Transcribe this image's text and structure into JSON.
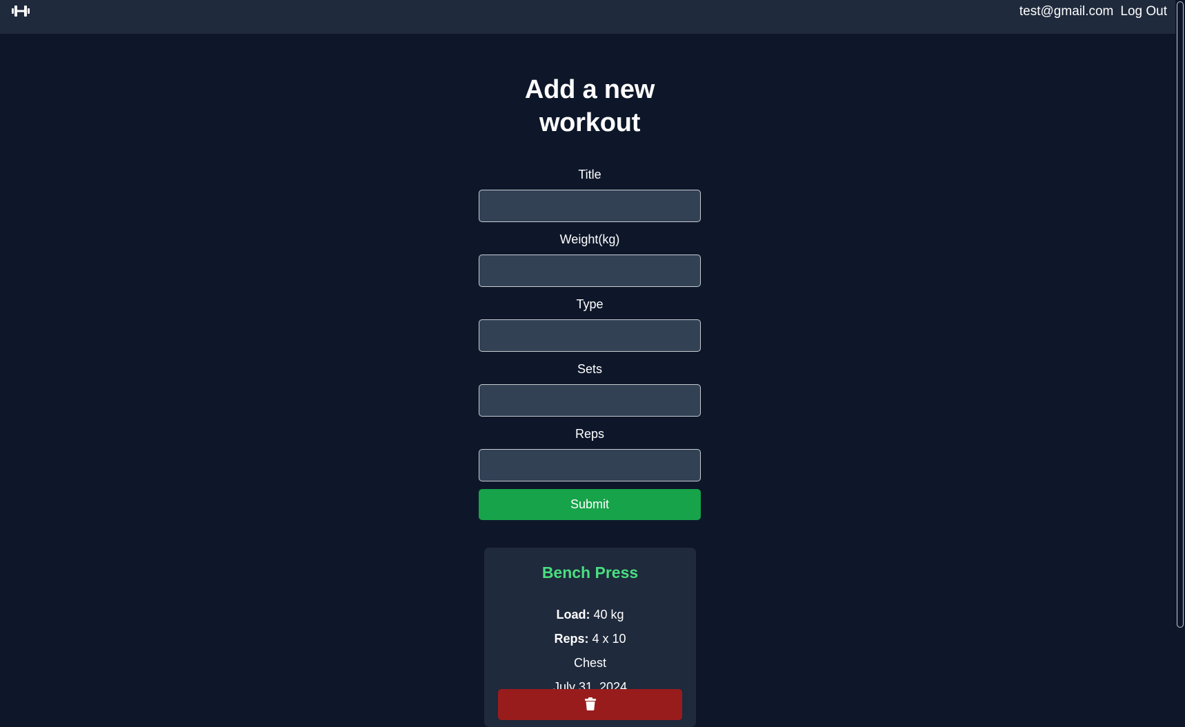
{
  "navbar": {
    "logo_icon": "dumbbell-icon",
    "user_email": "test@gmail.com",
    "logout_label": "Log Out"
  },
  "form": {
    "title": "Add a new workout",
    "fields": [
      {
        "label": "Title",
        "value": "",
        "placeholder": ""
      },
      {
        "label": "Weight(kg)",
        "value": "",
        "placeholder": ""
      },
      {
        "label": "Type",
        "value": "",
        "placeholder": ""
      },
      {
        "label": "Sets",
        "value": "",
        "placeholder": ""
      },
      {
        "label": "Reps",
        "value": "",
        "placeholder": ""
      }
    ],
    "submit_label": "Submit"
  },
  "workouts": [
    {
      "title": "Bench Press",
      "load_label": "Load:",
      "load_value": "40 kg",
      "reps_label": "Reps:",
      "reps_value": "4 x 10",
      "type": "Chest",
      "date": "July 31, 2024",
      "delete_icon": "trash-icon"
    }
  ],
  "colors": {
    "background": "#0e172a",
    "navbar": "#1f2a3c",
    "input_bg": "#334155",
    "accent_green": "#17a34a",
    "title_green": "#4ade80",
    "delete_red": "#991c1c"
  }
}
